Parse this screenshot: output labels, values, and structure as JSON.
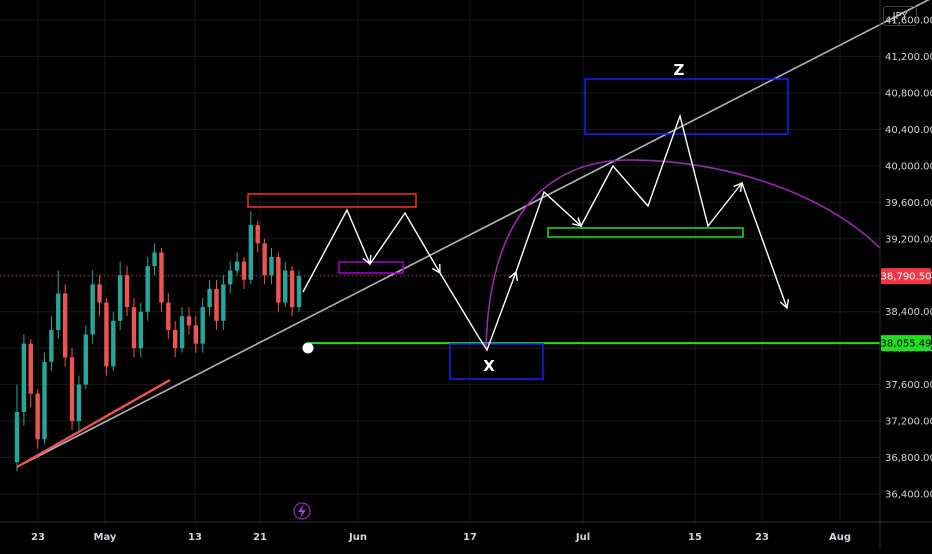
{
  "currency_label": "JPY",
  "colors": {
    "background": "#000000",
    "grid": "#1a1a1a",
    "up_candle": "#26a69a",
    "down_candle": "#ef5350",
    "trendline": "#b2b5be",
    "trendline_touch": "#ef5350",
    "projection_path": "#ffffff",
    "support_line": "#22dd22",
    "dome_curve": "#9c27b0",
    "box_red": "#ff2a2a",
    "box_purple": "#b000d0",
    "box_blue": "#1a1aff",
    "box_green": "#22dd22",
    "price_tag_last": "#f23645",
    "price_tag_support": "#22dd22"
  },
  "chart_data": {
    "type": "candlestick",
    "title": "",
    "ylim": [
      36100,
      41900
    ],
    "y_ticks": [
      "36,400.00",
      "36,800.00",
      "37,200.00",
      "37,600.00",
      "38,000.00",
      "38,400.00",
      "38,800.00",
      "39,200.00",
      "39,600.00",
      "40,000.00",
      "40,400.00",
      "40,800.00",
      "41,200.00",
      "41,600.00"
    ],
    "x_ticks": [
      "23",
      "May",
      "13",
      "21",
      "Jun",
      "17",
      "Jul",
      "15",
      "23",
      "Aug"
    ],
    "last_price": "38,790.50",
    "support_price": "38,055.49",
    "candles": {
      "start_close": 36750,
      "closes": [
        37300,
        38050,
        37500,
        37000,
        37850,
        38200,
        38600,
        37900,
        37200,
        37600,
        38150,
        38700,
        38500,
        37800,
        38300,
        38800,
        38450,
        38000,
        38400,
        38900,
        39050,
        38500,
        38200,
        38000,
        38350,
        38250,
        38050,
        38450,
        38650,
        38300,
        38700,
        38850,
        38950,
        38750,
        39350,
        39150,
        38800,
        39000,
        38500,
        38850,
        38450,
        38790.5
      ],
      "highs": [
        37600,
        38150,
        38100,
        37550,
        37950,
        38350,
        38850,
        38700,
        38000,
        37700,
        38250,
        38850,
        38800,
        38550,
        38400,
        38950,
        38900,
        38550,
        38500,
        39000,
        39150,
        39100,
        38600,
        38300,
        38450,
        38450,
        38350,
        38550,
        38750,
        38750,
        38800,
        38950,
        39050,
        39000,
        39500,
        39400,
        39200,
        39100,
        39050,
        38950,
        38900,
        38850
      ],
      "lows": [
        36650,
        37150,
        37350,
        36900,
        36950,
        37750,
        38100,
        37800,
        37100,
        37100,
        37550,
        38050,
        38350,
        37700,
        37750,
        38200,
        38350,
        37900,
        37900,
        38300,
        38800,
        38400,
        38100,
        37900,
        37950,
        38150,
        37950,
        37950,
        38350,
        38200,
        38200,
        38600,
        38800,
        38650,
        38700,
        39050,
        38700,
        38700,
        38400,
        38450,
        38350,
        38400
      ]
    },
    "annotations": {
      "labels": [
        "X",
        "Z"
      ]
    }
  }
}
